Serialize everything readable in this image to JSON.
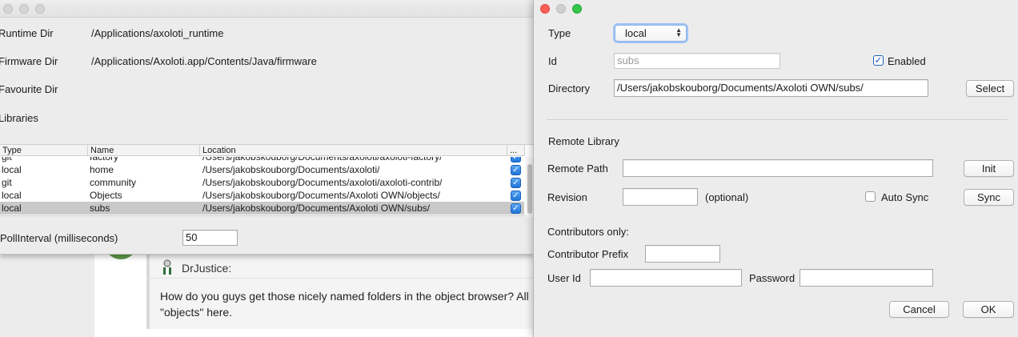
{
  "forum": {
    "author": "DrJustice:",
    "body_line1": "How do you guys get those nicely named folders in the object browser? All",
    "body_line2": "\"objects\" here."
  },
  "prefs": {
    "runtime_dir_label": "Runtime Dir",
    "runtime_dir_value": "/Applications/axoloti_runtime",
    "firmware_dir_label": "Firmware Dir",
    "firmware_dir_value": "/Applications/Axoloti.app/Contents/Java/firmware",
    "favourite_dir_label": "Favourite Dir",
    "libraries_label": "Libraries",
    "table": {
      "columns": [
        "Type",
        "Name",
        "Location",
        "..."
      ],
      "rows": [
        {
          "type": "git",
          "name": "factory",
          "location": "/Users/jakobskouborg/Documents/axoloti/axoloti-factory/",
          "enabled": true
        },
        {
          "type": "local",
          "name": "home",
          "location": "/Users/jakobskouborg/Documents/axoloti/",
          "enabled": true
        },
        {
          "type": "git",
          "name": "community",
          "location": "/Users/jakobskouborg/Documents/axoloti/axoloti-contrib/",
          "enabled": true
        },
        {
          "type": "local",
          "name": "Objects",
          "location": "/Users/jakobskouborg/Documents/Axoloti OWN/objects/",
          "enabled": true
        },
        {
          "type": "local",
          "name": "subs",
          "location": "/Users/jakobskouborg/Documents/Axoloti OWN/subs/",
          "enabled": true,
          "selected": true
        }
      ]
    },
    "poll_label": "PollInterval (milliseconds)",
    "poll_value": "50"
  },
  "dialog": {
    "type_label": "Type",
    "type_value": "local",
    "id_label": "Id",
    "id_value": "subs",
    "enabled_label": "Enabled",
    "enabled_checked": true,
    "directory_label": "Directory",
    "directory_value": "/Users/jakobskouborg/Documents/Axoloti OWN/subs/",
    "select_button": "Select",
    "remote_library_label": "Remote Library",
    "remote_path_label": "Remote Path",
    "remote_path_value": "",
    "init_button": "Init",
    "revision_label": "Revision",
    "revision_value": "",
    "optional_label": "(optional)",
    "auto_sync_label": "Auto Sync",
    "auto_sync_checked": false,
    "sync_button": "Sync",
    "contributors_only_label": "Contributors only:",
    "contributor_prefix_label": "Contributor Prefix",
    "contributor_prefix_value": "",
    "user_id_label": "User Id",
    "user_id_value": "",
    "password_label": "Password",
    "password_value": "",
    "cancel_button": "Cancel",
    "ok_button": "OK"
  },
  "colors": {
    "selection_row": "#c9c9c9",
    "checkbox_blue": "#1f74d8",
    "close_red": "#fc5f57",
    "zoom_green": "#34c84a"
  }
}
